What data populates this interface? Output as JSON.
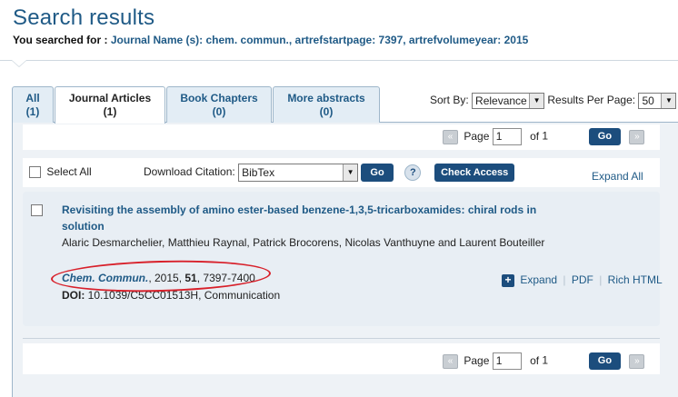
{
  "header": {
    "title": "Search results",
    "searched_prefix": "You searched for :",
    "query": "Journal Name (s): chem. commun., artrefstartpage: 7397, artrefvolumeyear: 2015"
  },
  "tabs": [
    {
      "label": "All",
      "count": "(1)"
    },
    {
      "label": "Journal Articles",
      "count": "(1)"
    },
    {
      "label": "Book Chapters",
      "count": "(0)"
    },
    {
      "label": "More abstracts",
      "count": "(0)"
    }
  ],
  "sort": {
    "label": "Sort By:",
    "value": "Relevance",
    "per_page_label": "Results Per Page:",
    "per_page_value": "50"
  },
  "pager": {
    "page_label": "Page",
    "page_value": "1",
    "of_label": "of",
    "total": "1",
    "go_label": "Go",
    "prev": "«",
    "next": "»"
  },
  "toolbar": {
    "select_all": "Select All",
    "download_label": "Download Citation:",
    "download_value": "BibTex",
    "go_label": "Go",
    "help": "?",
    "check_access": "Check Access",
    "expand_all": "Expand All"
  },
  "result": {
    "title": "Revisiting the assembly of amino ester-based benzene-1,3,5-tricarboxamides: chiral rods in solution",
    "authors": "Alaric Desmarchelier, Matthieu Raynal, Patrick Brocorens, Nicolas Vanthuyne and Laurent Bouteiller",
    "journal": "Chem. Commun.",
    "year_sep": ", 2015, ",
    "volume": "51",
    "pages": ", 7397-7400",
    "doi_label": "DOI:",
    "doi": " 10.1039/C5CC01513H, Communication",
    "expand": "Expand",
    "pdf": "PDF",
    "rich_html": "Rich HTML"
  },
  "colors": {
    "accent": "#1f5a86",
    "button": "#1c4d7d",
    "annotation": "#d8202a"
  }
}
